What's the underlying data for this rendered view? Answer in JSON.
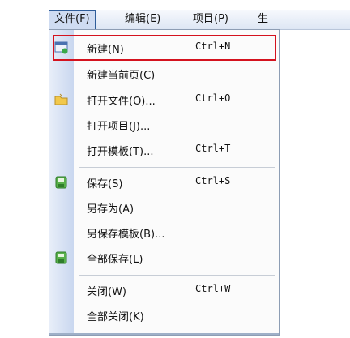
{
  "menubar": {
    "items": [
      {
        "label": "文件(F)"
      },
      {
        "label": "编辑(E)"
      },
      {
        "label": "项目(P)"
      },
      {
        "label": "生"
      }
    ]
  },
  "file_menu": {
    "items": [
      {
        "label": "新建(N)",
        "shortcut": "Ctrl+N",
        "icon": "new-document-icon"
      },
      {
        "label": "新建当前页(C)",
        "shortcut": ""
      },
      {
        "label": "打开文件(O)...",
        "shortcut": "Ctrl+O",
        "icon": "open-folder-icon"
      },
      {
        "label": "打开项目(J)...",
        "shortcut": ""
      },
      {
        "label": "打开模板(T)...",
        "shortcut": "Ctrl+T"
      },
      {
        "label": "保存(S)",
        "shortcut": "Ctrl+S",
        "icon": "save-icon"
      },
      {
        "label": "另存为(A)",
        "shortcut": ""
      },
      {
        "label": "另保存模板(B)...",
        "shortcut": ""
      },
      {
        "label": "全部保存(L)",
        "shortcut": "",
        "icon": "save-all-icon"
      },
      {
        "label": "关闭(W)",
        "shortcut": "Ctrl+W"
      },
      {
        "label": "全部关闭(K)",
        "shortcut": ""
      }
    ]
  },
  "colors": {
    "highlight_border": "#d4121e",
    "icon_column": "#c9d7ef"
  }
}
